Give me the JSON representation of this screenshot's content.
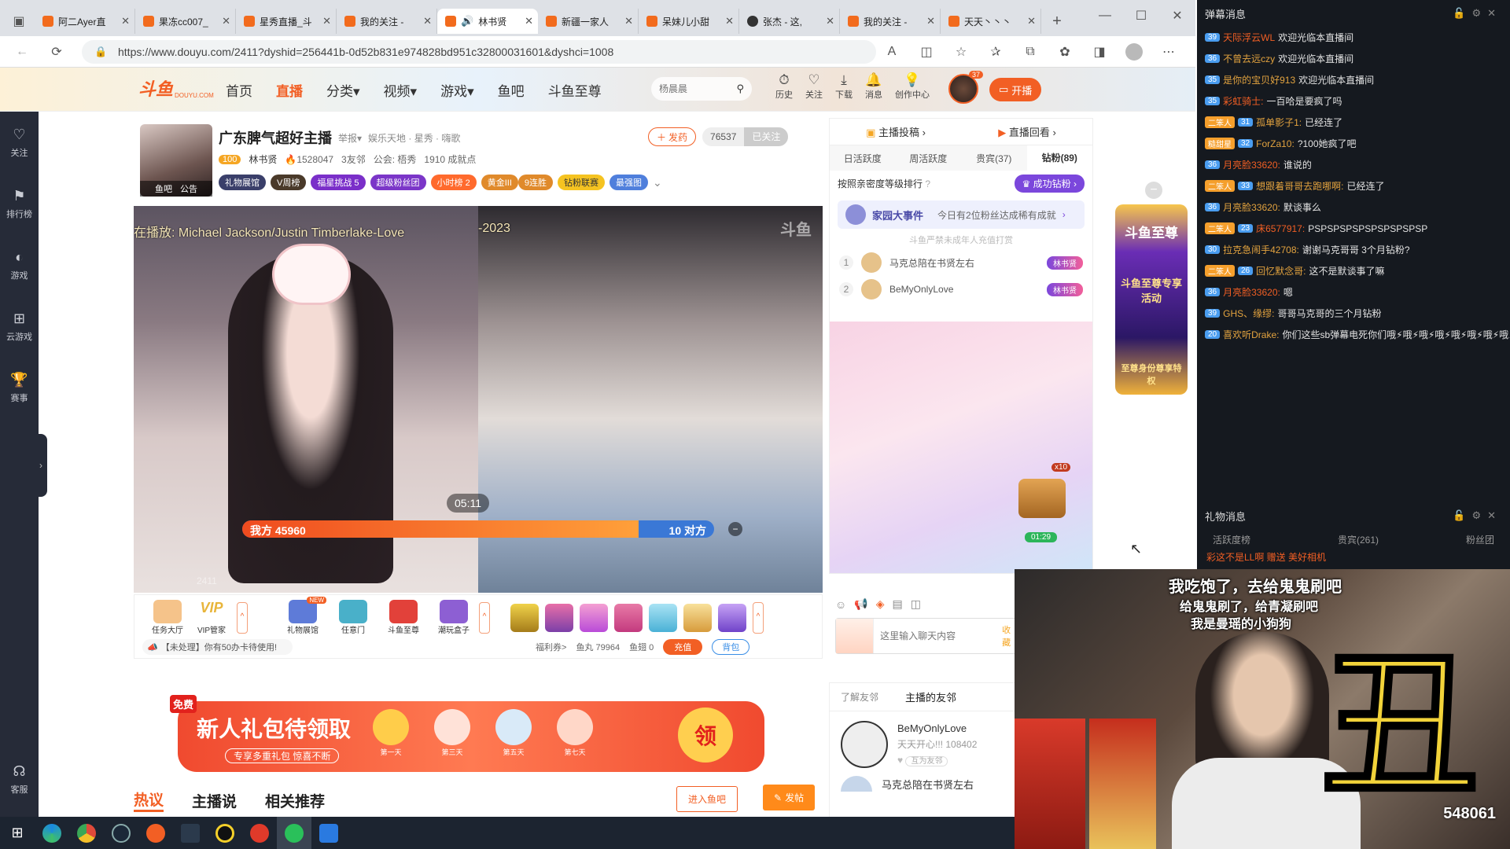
{
  "browser": {
    "tabs": [
      {
        "label": "阿二Ayer直"
      },
      {
        "label": "果冻cc007_"
      },
      {
        "label": "星秀直播_斗"
      },
      {
        "label": "我的关注 - "
      },
      {
        "label": "林书贤"
      },
      {
        "label": "新疆一家人"
      },
      {
        "label": "呆妹儿小甜"
      },
      {
        "label": "张杰 - 这,"
      },
      {
        "label": "我的关注 -"
      },
      {
        "label": "天天丶丶丶"
      }
    ],
    "url": "https://www.douyu.com/2411?dyshid=256441b-0d52b831e974828bd951c32800031601&dyshci=1008"
  },
  "header": {
    "logo": "斗鱼",
    "logo_sub": "DOUYU.COM",
    "nav": [
      "首页",
      "直播",
      "分类",
      "视频",
      "游戏",
      "鱼吧",
      "斗鱼至尊"
    ],
    "search_placeholder": "杨晨晨",
    "icons": [
      "历史",
      "关注",
      "下载",
      "消息",
      "创作中心"
    ],
    "avatar_count": "37",
    "live_btn": "开播"
  },
  "rail": [
    "关注",
    "排行榜",
    "游戏",
    "云游戏",
    "赛事",
    "客服"
  ],
  "room": {
    "title": "广东脾气超好主播",
    "report": "举报",
    "breadcrumb": "娱乐天地 · 星秀 · 嗨歌",
    "level": "100",
    "anchor": "林书贤",
    "hot": "1528047",
    "friends": "3友邻",
    "guild": "公会: 梧秀",
    "achieve": "1910 成就点",
    "send_btn": "发药",
    "follow_count": "76537",
    "followed": "已关注",
    "avatar_tags": [
      "鱼吧",
      "公告"
    ],
    "badges": [
      "礼物展馆",
      "V周榜",
      "福星挑战 5",
      "超级粉丝团",
      "小时榜 2",
      "黄金III",
      "9连胜",
      "钻粉联赛",
      "最强图"
    ],
    "song": "在播放: Michael Jackson/Justin Timberlake-Love",
    "year": "-2023",
    "room_id": "2411",
    "pk_time": "05:11",
    "our_side": "我方 45960",
    "their_side": "10 对方",
    "watermark": "斗鱼"
  },
  "gift_bar": {
    "items": [
      "任务大厅",
      "VIP管家",
      "礼物展馆",
      "任意门",
      "斗鱼至尊",
      "潮玩盒子"
    ],
    "new_tag": "NEW",
    "notice": "【未处理】你有50办卡待使用!",
    "welfare": "福利券>",
    "yuwan": "鱼丸 79964",
    "yuchi": "鱼翅 0",
    "charge": "充值",
    "bag": "背包"
  },
  "promo": {
    "free": "免费",
    "title": "新人礼包待领取",
    "sub": "专享多重礼包 惊喜不断",
    "days": [
      "第一天",
      "第三天",
      "第五天",
      "第七天"
    ],
    "get": "领"
  },
  "bottom_tabs": [
    "热议",
    "主播说",
    "相关推荐"
  ],
  "bottom_btns": {
    "enter": "进入鱼吧",
    "post": "发帖"
  },
  "side": {
    "top": [
      "主播投稿",
      "直播回看"
    ],
    "tabs": [
      "日活跃度",
      "周活跃度",
      "贵宾(37)",
      "钻粉(89)"
    ],
    "sort": "按照亲密度等级排行",
    "success_btn": "成功钻粉",
    "family": "家园大事件",
    "family_info": "今日有2位粉丝达成稀有成就",
    "notice": "斗鱼严禁未成年人充值打赏",
    "ranks": [
      {
        "n": "1",
        "name": "马克总陪在书贤左右",
        "tag": "林书贤"
      },
      {
        "n": "2",
        "name": "BeMyOnlyLove",
        "tag": "林书贤"
      }
    ],
    "chest_x": "x10",
    "chest_time": "01:29",
    "input_placeholder": "这里输入聊天内容",
    "send": "收藏",
    "friend_tabs": [
      "了解友邻",
      "主播的友邻"
    ],
    "friends": [
      {
        "name": "BeMyOnlyLove",
        "msg": "天天开心!!!",
        "num": "108402",
        "tag": "互为友邻"
      },
      {
        "name": "马克总陪在书贤左右"
      }
    ]
  },
  "banner_right": {
    "title": "斗鱼至尊",
    "sub": "斗鱼至尊专享活动",
    "foot": "至尊身份尊享特权"
  },
  "danmaku": {
    "title": "弹幕消息",
    "rows": [
      {
        "lv": "39",
        "user": "天际浮云WL",
        "text": "欢迎光临本直播间"
      },
      {
        "lv": "36",
        "user": "不曾去远czy",
        "text": "欢迎光临本直播间"
      },
      {
        "lv": "35",
        "user": "是你的宝贝好913",
        "text": "欢迎光临本直播间"
      },
      {
        "lv": "35",
        "user": "彩虹骑士:",
        "text": "一百哈是要疯了吗"
      },
      {
        "fan": "二笨人",
        "lv": "31",
        "user": "孤单影子1:",
        "text": "已经连了"
      },
      {
        "fan": "糙甜星",
        "lv": "32",
        "user": "ForZa10:",
        "text": "?100她疯了吧"
      },
      {
        "lv": "36",
        "user": "月亮脸33620:",
        "text": "谁说的"
      },
      {
        "fan": "二笨人",
        "lv": "33",
        "user": "想跟着哥哥去跑哪啊:",
        "text": "已经连了"
      },
      {
        "lv": "36",
        "user": "月亮脸33620:",
        "text": "默谈事么"
      },
      {
        "fan": "二笨人",
        "lv": "23",
        "user": "床6577917:",
        "text": "PSPSPSPSPSPSPSPSPSP"
      },
      {
        "lv": "30",
        "user": "拉克急闹手42708:",
        "text": "谢谢马克哥哥 3个月钻粉?"
      },
      {
        "fan": "二笨人",
        "lv": "26",
        "user": "回忆默念哥:",
        "text": "这不是默谈事了嘛"
      },
      {
        "lv": "36",
        "user": "月亮脸33620:",
        "text": "嗯"
      },
      {
        "lv": "39",
        "user": "GHS、缘缪:",
        "text": "哥哥马克哥的三个月钻粉"
      },
      {
        "lv": "20",
        "user": "喜欢听Drake:",
        "text": "你们这些sb弹幕电死你们哦⚡哦⚡哦⚡哦⚡哦⚡哦⚡哦⚡哦⚡"
      }
    ]
  },
  "gift_msgs": {
    "title": "礼物消息",
    "tabs": [
      "活跃度榜",
      "贵宾(261)",
      "粉丝团"
    ],
    "row": "彩这不是LL啊 赠送 美好相机"
  },
  "overlay": {
    "line1": "我吃饱了，去给鬼鬼刷吧",
    "line2": "给鬼鬼刷了，给青凝刷吧",
    "line3": "我是曼瑶的小狗狗",
    "big": "丑",
    "count": "548061"
  },
  "taskbar": {
    "apps": [
      "start",
      "edge",
      "chrome",
      "steam",
      "douyu",
      "terminal",
      "obs",
      "weibo",
      "wechat",
      "k"
    ]
  }
}
